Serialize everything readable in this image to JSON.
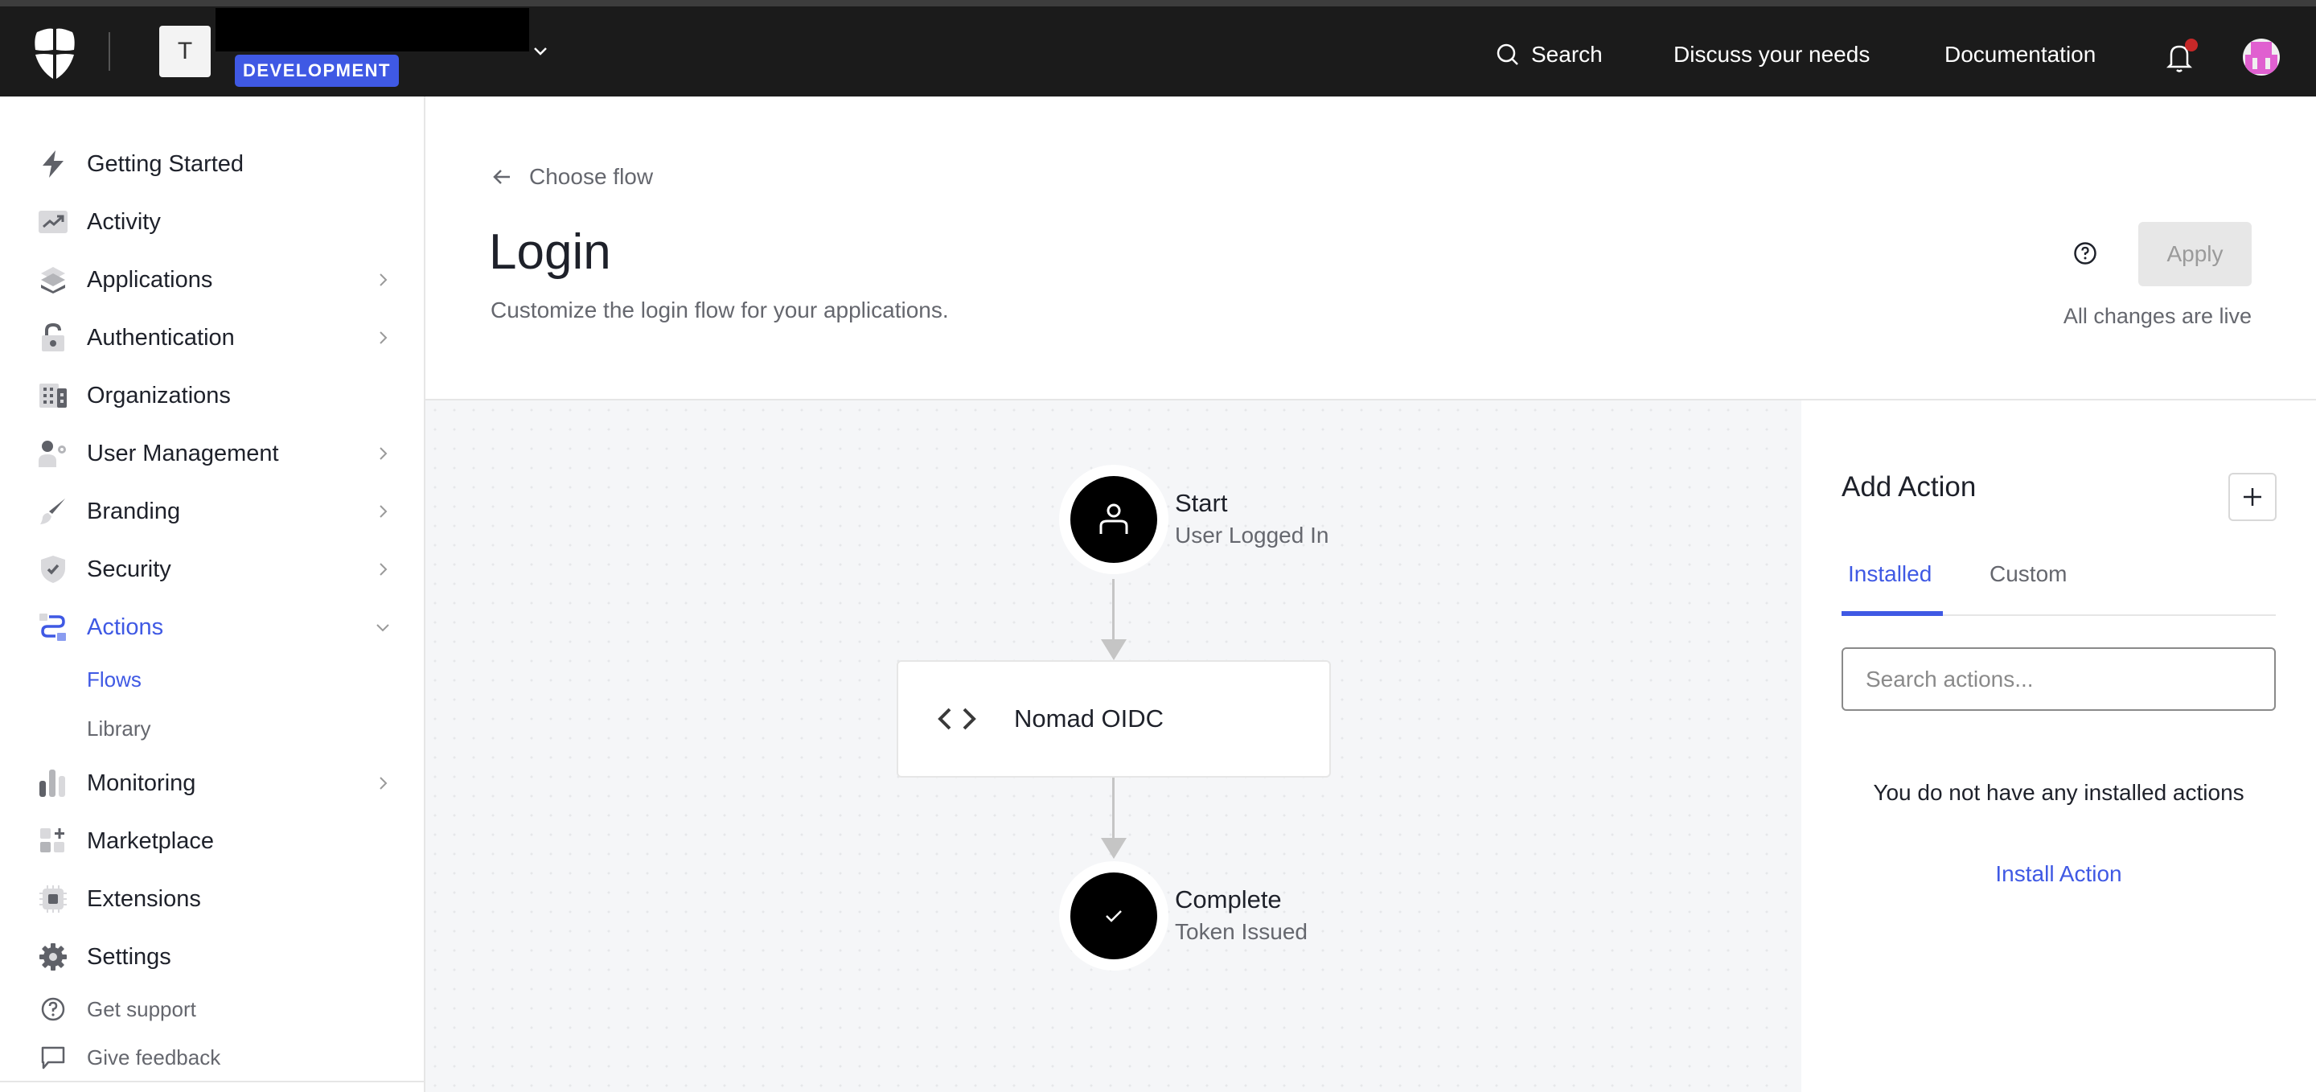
{
  "topbar": {
    "tenant_initial": "T",
    "environment_badge": "DEVELOPMENT",
    "search_label": "Search",
    "discuss_label": "Discuss your needs",
    "docs_label": "Documentation",
    "notification_dot_color": "#c62828",
    "avatar_color": "#e060d0"
  },
  "sidebar": {
    "items": [
      {
        "label": "Getting Started",
        "icon": "lightning-icon",
        "has_chevron": false
      },
      {
        "label": "Activity",
        "icon": "trend-chart-icon",
        "has_chevron": false
      },
      {
        "label": "Applications",
        "icon": "layers-icon",
        "has_chevron": true
      },
      {
        "label": "Authentication",
        "icon": "unlock-icon",
        "has_chevron": true
      },
      {
        "label": "Organizations",
        "icon": "building-icon",
        "has_chevron": false
      },
      {
        "label": "User Management",
        "icon": "user-gear-icon",
        "has_chevron": true
      },
      {
        "label": "Branding",
        "icon": "paintbrush-icon",
        "has_chevron": true
      },
      {
        "label": "Security",
        "icon": "shield-check-icon",
        "has_chevron": true
      },
      {
        "label": "Actions",
        "icon": "actions-flow-icon",
        "has_chevron": true,
        "expanded": true,
        "active": true
      },
      {
        "label": "Monitoring",
        "icon": "bar-chart-icon",
        "has_chevron": true
      },
      {
        "label": "Marketplace",
        "icon": "grid-plus-icon",
        "has_chevron": false
      },
      {
        "label": "Extensions",
        "icon": "chip-icon",
        "has_chevron": false
      },
      {
        "label": "Settings",
        "icon": "gear-icon",
        "has_chevron": false
      }
    ],
    "sub_items": [
      {
        "label": "Flows",
        "active": true
      },
      {
        "label": "Library",
        "active": false
      }
    ],
    "utility": [
      {
        "label": "Get support",
        "icon": "help-circle-icon"
      },
      {
        "label": "Give feedback",
        "icon": "chat-bubble-icon"
      }
    ]
  },
  "header": {
    "back_label": "Choose flow",
    "title": "Login",
    "description": "Customize the login flow for your applications.",
    "apply_label": "Apply",
    "live_note": "All changes are live"
  },
  "flow": {
    "start": {
      "title": "Start",
      "subtitle": "User Logged In"
    },
    "actions": [
      {
        "name": "Nomad OIDC"
      }
    ],
    "end": {
      "title": "Complete",
      "subtitle": "Token Issued"
    }
  },
  "panel": {
    "title": "Add Action",
    "tabs": [
      {
        "label": "Installed",
        "active": true
      },
      {
        "label": "Custom",
        "active": false
      }
    ],
    "search_placeholder": "Search actions...",
    "search_value": "",
    "empty_message": "You do not have any installed actions",
    "install_link": "Install Action"
  },
  "colors": {
    "accent": "#3f59e4",
    "topbar_bg": "#1b1b1b",
    "canvas_bg": "#f5f6f8"
  }
}
